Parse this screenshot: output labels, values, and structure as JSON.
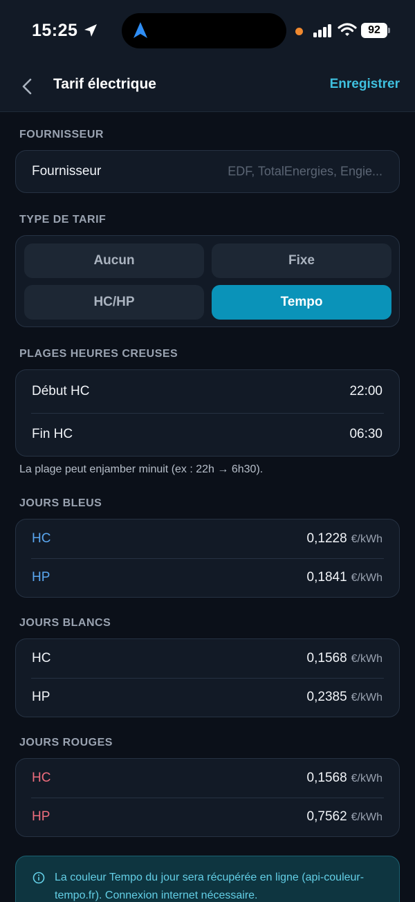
{
  "status_bar": {
    "time": "15:25",
    "battery": "92"
  },
  "nav": {
    "title": "Tarif électrique",
    "save_label": "Enregistrer"
  },
  "supplier": {
    "section_title": "FOURNISSEUR",
    "label": "Fournisseur",
    "placeholder": "EDF, TotalEnergies, Engie..."
  },
  "tariff_type": {
    "section_title": "TYPE DE TARIF",
    "options": [
      "Aucun",
      "Fixe",
      "HC/HP",
      "Tempo"
    ],
    "selected": "Tempo"
  },
  "off_peak": {
    "section_title": "PLAGES HEURES CREUSES",
    "start_label": "Début HC",
    "start_value": "22:00",
    "end_label": "Fin HC",
    "end_value": "06:30",
    "hint": "La plage peut enjamber minuit (ex : 22h → 6h30)."
  },
  "unit": "€/kWh",
  "blue_days": {
    "section_title": "JOURS BLEUS",
    "color": "#5aa7f0",
    "hc_label": "HC",
    "hc_value": "0,1228",
    "hp_label": "HP",
    "hp_value": "0,1841"
  },
  "white_days": {
    "section_title": "JOURS BLANCS",
    "color": "#f1f4f8",
    "hc_label": "HC",
    "hc_value": "0,1568",
    "hp_label": "HP",
    "hp_value": "0,2385"
  },
  "red_days": {
    "section_title": "JOURS ROUGES",
    "color": "#ee6d7d",
    "hc_label": "HC",
    "hc_value": "0,1568",
    "hp_label": "HP",
    "hp_value": "0,7562"
  },
  "info": {
    "text": "La couleur Tempo du jour sera récupérée en ligne (api-couleur-tempo.fr). Connexion internet nécessaire."
  },
  "colors": {
    "accent": "#0a93b9",
    "link": "#3fc0df"
  }
}
